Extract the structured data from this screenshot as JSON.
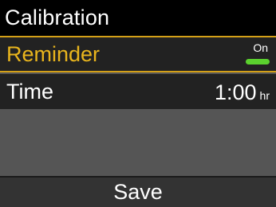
{
  "header": {
    "title": "Calibration"
  },
  "menu": {
    "reminder": {
      "label": "Reminder",
      "toggle_text": "On",
      "enabled": true,
      "selected": true,
      "highlight_color": "#d4a017",
      "toggle_color": "#5bd12e"
    },
    "time": {
      "label": "Time",
      "value": "1:00",
      "unit": "hr"
    }
  },
  "footer": {
    "save_label": "Save"
  }
}
